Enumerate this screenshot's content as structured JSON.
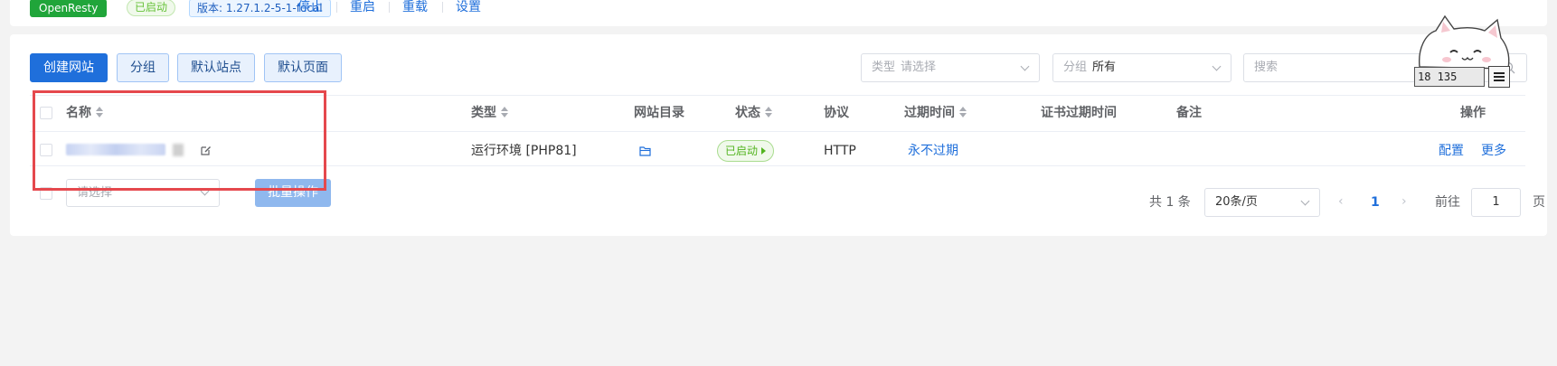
{
  "topbar": {
    "server_tag": "OpenResty",
    "status_tag": "已启动",
    "version_tag": "版本: 1.27.1.2-5-1-focal",
    "actions": [
      "停止",
      "重启",
      "重载",
      "设置"
    ]
  },
  "toolbar": {
    "create_label": "创建网站",
    "group_label": "分组",
    "default_site_label": "默认站点",
    "default_page_label": "默认页面",
    "type_filter": {
      "prefix": "类型",
      "placeholder": "请选择"
    },
    "group_filter": {
      "prefix": "分组",
      "value": "所有"
    },
    "search_placeholder": "搜索"
  },
  "table": {
    "columns": {
      "name": "名称",
      "type": "类型",
      "directory": "网站目录",
      "status": "状态",
      "protocol": "协议",
      "expiry": "过期时间",
      "cert_expiry": "证书过期时间",
      "remark": "备注",
      "actions": "操作"
    },
    "rows": [
      {
        "type": "运行环境 [PHP81]",
        "status": "已启动",
        "protocol": "HTTP",
        "expiry": "永不过期",
        "action_config": "配置",
        "action_more": "更多"
      }
    ]
  },
  "batch": {
    "select_placeholder": "请选择",
    "button_label": "批量操作"
  },
  "pagination": {
    "total_text": "共 1 条",
    "page_size": "20条/页",
    "current_page": "1",
    "goto_prefix": "前往",
    "goto_value": "1",
    "goto_suffix": "页"
  },
  "overlay": {
    "widget_text": "18 135"
  },
  "colors": {
    "primary": "#1f6fdb",
    "success": "#20a53a",
    "highlight_box": "#e5484d"
  }
}
